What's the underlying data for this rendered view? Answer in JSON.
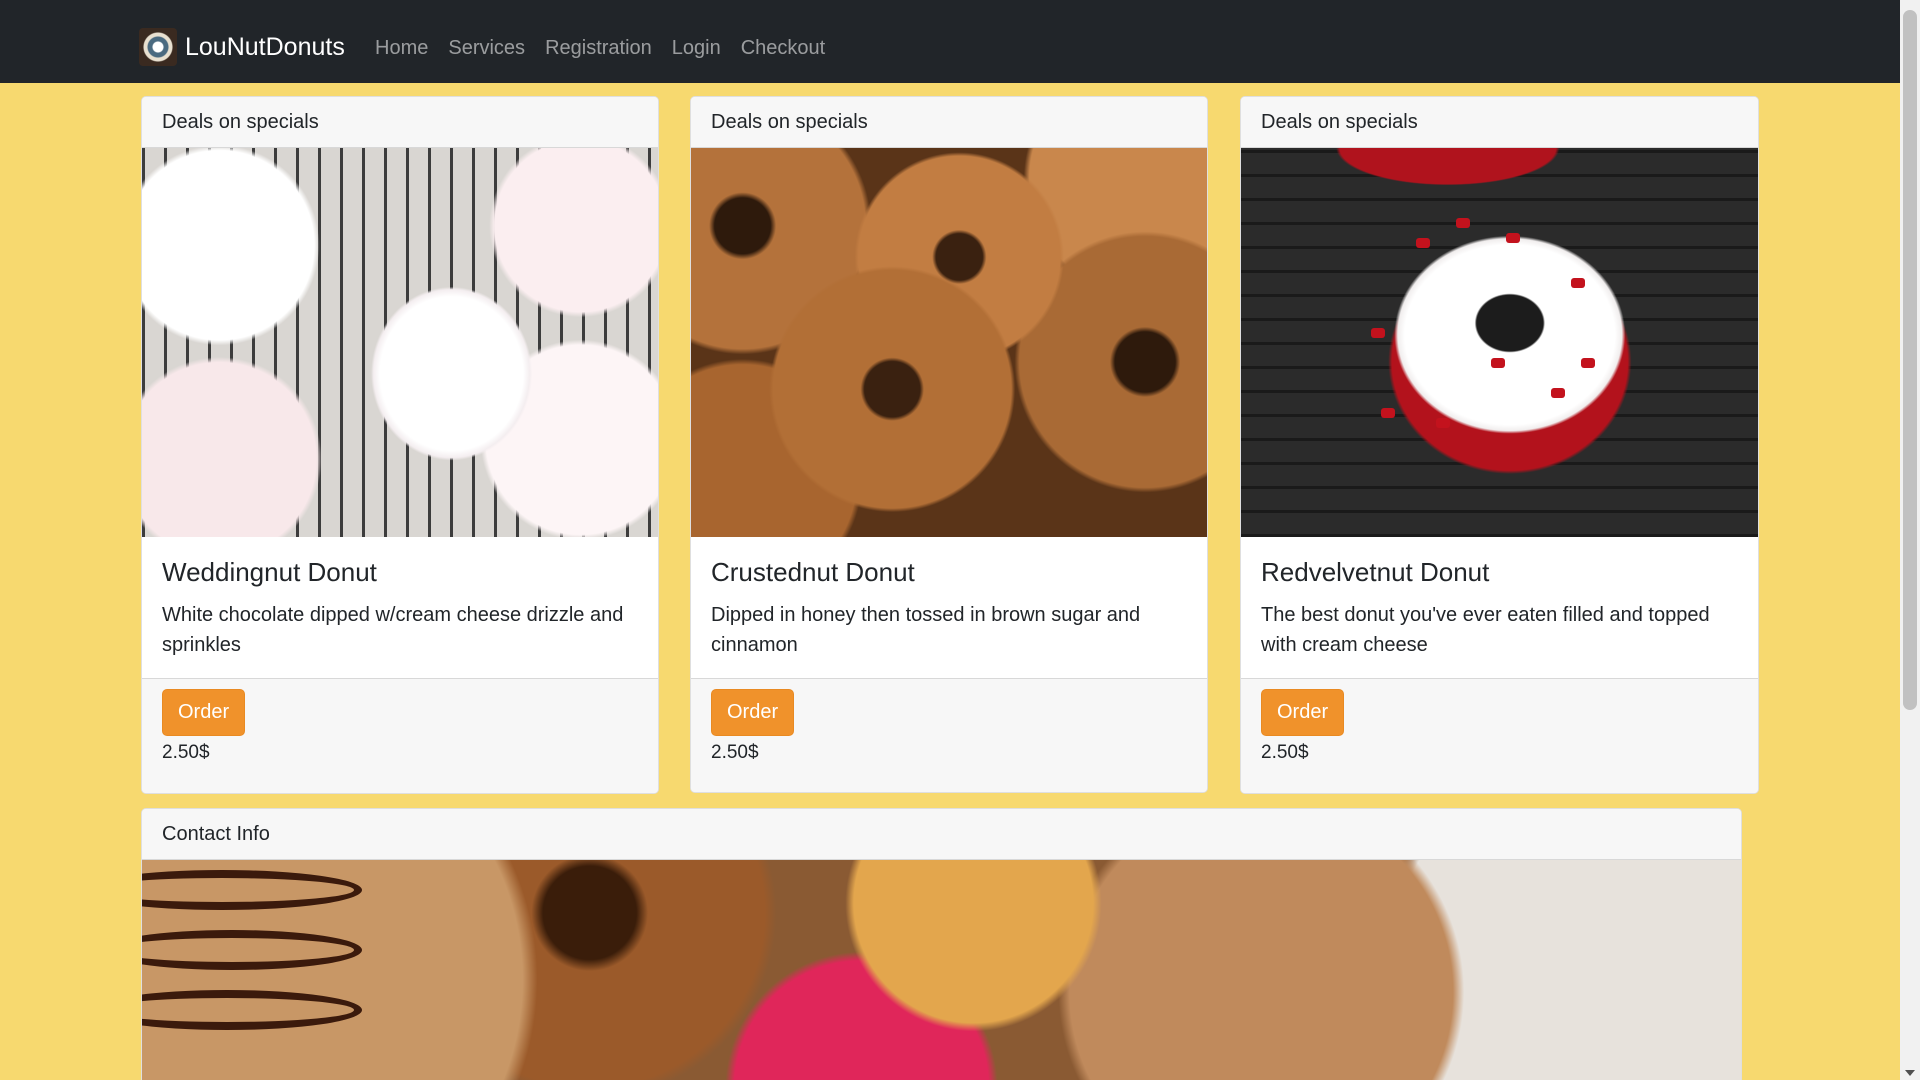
{
  "navbar": {
    "brand": "LouNutDonuts",
    "links": [
      "Home",
      "Services",
      "Registration",
      "Login",
      "Checkout"
    ]
  },
  "cards": [
    {
      "header": "Deals on specials",
      "title": "Weddingnut Donut",
      "text": "White chocolate dipped w/cream cheese drizzle and sprinkles",
      "button": "Order",
      "price": "2.50$",
      "image": "weddingnut-donut-photo"
    },
    {
      "header": "Deals on specials",
      "title": "Crustednut Donut",
      "text": "Dipped in honey then tossed in brown sugar and cinnamon",
      "button": "Order",
      "price": "2.50$",
      "image": "crustednut-donut-photo"
    },
    {
      "header": "Deals on specials",
      "title": "Redvelvetnut Donut",
      "text": "The best donut you've ever eaten filled and topped with cream cheese",
      "button": "Order",
      "price": "2.50$",
      "image": "redvelvetnut-donut-photo"
    }
  ],
  "contact": {
    "header": "Contact Info",
    "image": "assorted-donuts-photo"
  },
  "colors": {
    "page_background": "#f7d96f",
    "navbar_background": "#212529",
    "order_button": "#f0922b"
  }
}
